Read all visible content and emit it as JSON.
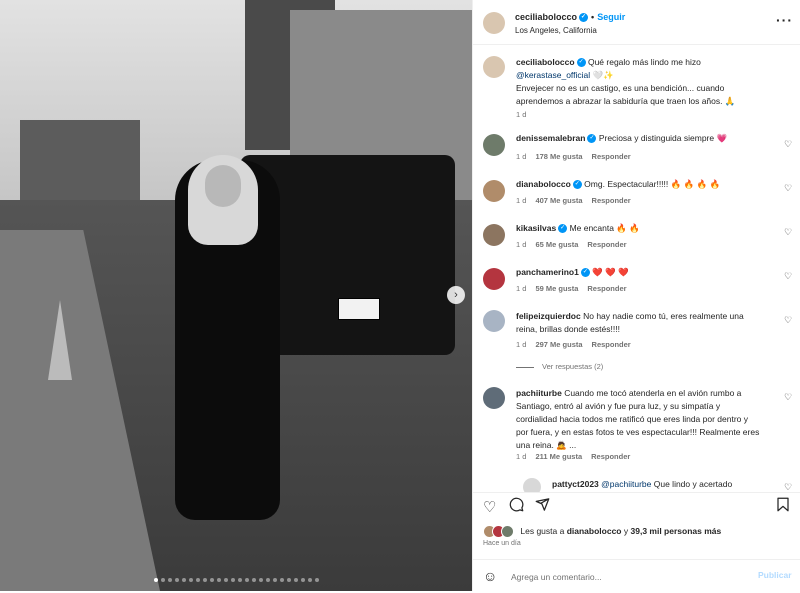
{
  "post": {
    "username": "ceciliabolocco",
    "follow_label": "Seguir",
    "separator": "•",
    "location": "Los Angeles, California",
    "more_label": "···",
    "caption_line1": "Qué regalo más lindo me hizo",
    "caption_mention": "@kerastase_official",
    "caption_emoji": "🤍✨",
    "caption_body": "Envejecer no es un castigo, es una bendición... cuando aprendemos a abrazar la sabiduría que traen los años. 🙏",
    "caption_time": "1 d"
  },
  "photo": {
    "next_label": "›",
    "plate_text": "1800BGA",
    "slides_total": 24,
    "slide_active": 1
  },
  "comments": [
    {
      "user": "denissemalebran",
      "text": "Preciosa y distinguida siempre 💗",
      "time": "1 d",
      "likes": "178 Me gusta",
      "reply": "Responder"
    },
    {
      "user": "dianabolocco",
      "text": "Omg. Espectacular!!!!! 🔥 🔥 🔥 🔥",
      "time": "1 d",
      "likes": "407 Me gusta",
      "reply": "Responder"
    },
    {
      "user": "kikasilvas",
      "text": "Me encanta 🔥 🔥",
      "time": "1 d",
      "likes": "65 Me gusta",
      "reply": "Responder"
    },
    {
      "user": "panchamerino1",
      "text": "❤️ ❤️ ❤️",
      "time": "1 d",
      "likes": "59 Me gusta",
      "reply": "Responder"
    },
    {
      "user": "felipeizquierdoc",
      "text": "No hay nadie como tú, eres realmente una reina, brillas donde estés!!!!",
      "time": "1 d",
      "likes": "297 Me gusta",
      "reply": "Responder",
      "view_replies": "Ver respuestas (2)"
    },
    {
      "user": "pachiiturbe",
      "text": "Cuando me tocó atenderla en el avión rumbo a Santiago, entró al avión y fue pura luz, y su simpatía y cordialidad hacia todos me ratificó que eres linda por dentro y por fuera, y en estas fotos te ves espectacular!!! Realmente eres una reina. 🙇 ...",
      "time": "1 d",
      "likes": "211 Me gusta",
      "reply": "Responder"
    },
    {
      "user": "pattyct2023",
      "mention": "@pachiiturbe",
      "text": "Que lindo y acertado"
    }
  ],
  "actions": {
    "likes_prefix": "Les gusta a",
    "likes_user": "dianabolocco",
    "likes_conj": "y",
    "likes_count": "39,3 mil personas más",
    "time_ago": "Hace un día",
    "comment_placeholder": "Agrega un comentario...",
    "publish_label": "Publicar"
  },
  "colors": {
    "accent": "#0095f6",
    "verified": "#0095f6",
    "publish_disabled": "#b3dbff",
    "link": "#00376b",
    "secondary_text": "#737373"
  }
}
